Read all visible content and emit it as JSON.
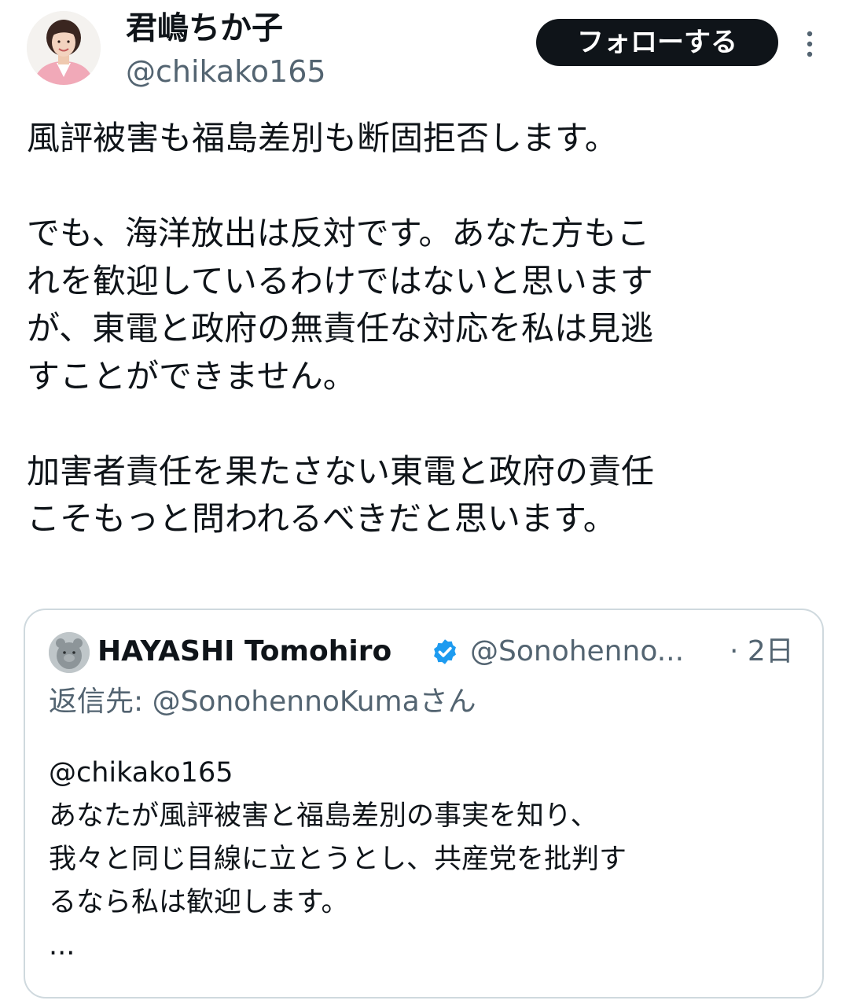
{
  "author": {
    "display_name": "君嶋ちか子",
    "handle": "@chikako165"
  },
  "follow_button": {
    "label": "フォローする"
  },
  "tweet": {
    "lines": [
      "風評被害も福島差別も断固拒否します。",
      "",
      "でも、海洋放出は反対です。あなた方もこ",
      "れを歓迎しているわけではないと思います",
      "が、東電と政府の無責任な対応を私は見逃",
      "すことができません。",
      "",
      "加害者責任を果たさない東電と政府の責任",
      "こそもっと問われるべきだと思います。"
    ]
  },
  "quoted_tweet": {
    "display_name": "HAYASHI Tomohiro",
    "handle": "@Sonohenno...",
    "time": "· 2日",
    "reply_context": "返信先: @SonohennoKumaさん",
    "lines": [
      "@chikako165",
      "あなたが風評被害と福島差別の事実を知り、",
      "我々と同じ目線に立とうとし、共産党を批判す",
      "るなら私は歓迎します。",
      "..."
    ]
  },
  "colors": {
    "text_primary": "#0f1419",
    "text_secondary": "#536471",
    "follow_button_bg": "#0f1419",
    "verified_badge": "#1d9bf0",
    "card_border": "#cfd9de"
  },
  "icons": {
    "more": "more-vertical-icon",
    "verified": "verified-badge-icon"
  }
}
